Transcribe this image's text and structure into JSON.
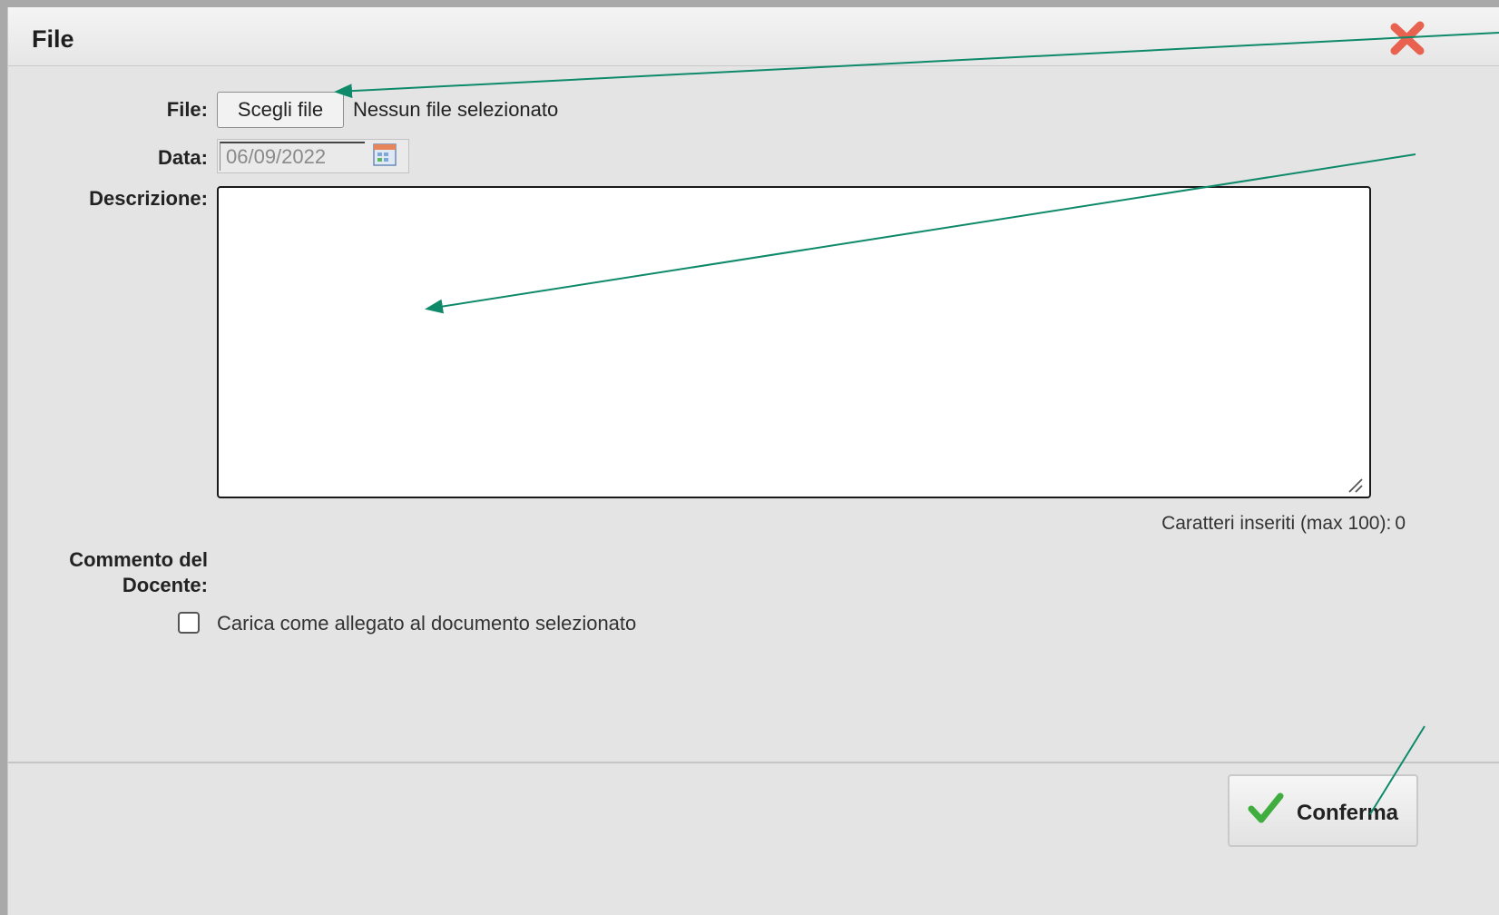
{
  "dialog": {
    "title": "File",
    "close_icon": "close-x-icon"
  },
  "form": {
    "file": {
      "label": "File:",
      "button_label": "Scegli file",
      "status": "Nessun file selezionato"
    },
    "date": {
      "label": "Data:",
      "value": "06/09/2022",
      "icon": "calendar-icon"
    },
    "description": {
      "label": "Descrizione:",
      "value": "",
      "counter_label": "Caratteri inseriti (max 100):",
      "counter_value": "0"
    },
    "teacher_comment": {
      "label_line1": "Commento del",
      "label_line2": "Docente:"
    },
    "attach_checkbox": {
      "label": "Carica come allegato al documento selezionato",
      "checked": false
    }
  },
  "footer": {
    "confirm_label": "Conferma",
    "confirm_icon": "checkmark-icon"
  },
  "colors": {
    "annotation_arrow": "#0e8a6a",
    "close_icon": "#e8624f",
    "checkmark": "#3fae3f"
  }
}
